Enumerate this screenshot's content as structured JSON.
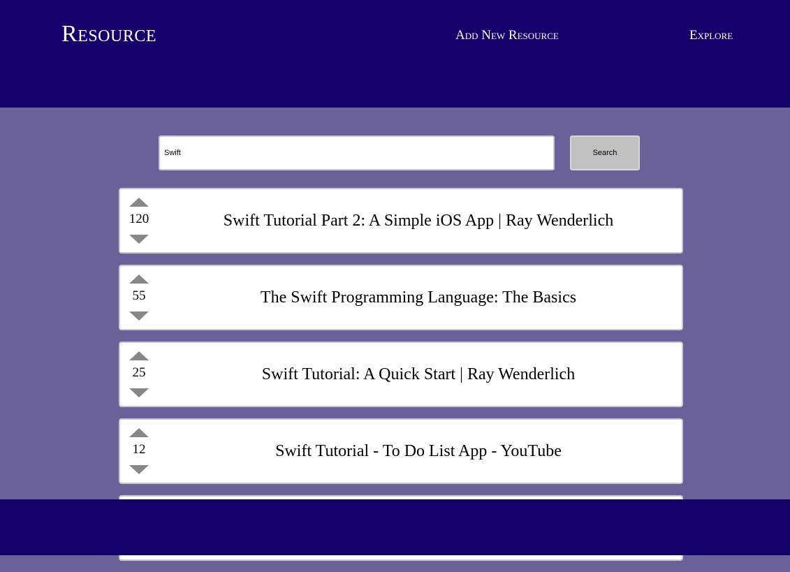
{
  "header": {
    "brand": "Resource",
    "nav": {
      "add_new": "Add New Resource",
      "explore": "Explore"
    }
  },
  "search": {
    "value": "Swift",
    "button_label": "Search"
  },
  "results": [
    {
      "score": "120",
      "title": "Swift Tutorial Part 2: A Simple iOS App | Ray Wenderlich"
    },
    {
      "score": "55",
      "title": "The Swift Programming Language: The Basics"
    },
    {
      "score": "25",
      "title": "Swift Tutorial: A Quick Start | Ray Wenderlich"
    },
    {
      "score": "12",
      "title": "Swift Tutorial - To Do List App - YouTube"
    },
    {
      "score": "",
      "title": ""
    }
  ],
  "colors": {
    "header_bg": "#14006a",
    "page_bg": "#6a6199",
    "arrow": "#888888",
    "button_bg": "#c0c0c0"
  },
  "icons": {
    "upvote": "triangle-up-icon",
    "downvote": "triangle-down-icon"
  }
}
